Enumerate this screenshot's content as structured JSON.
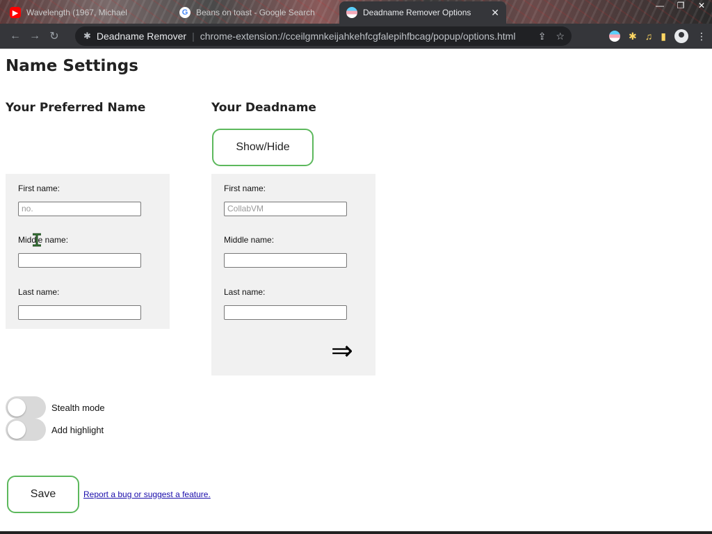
{
  "browser": {
    "tabs": [
      {
        "title": "Wavelength (1967, Michael",
        "icon": "youtube-icon"
      },
      {
        "title": "Beans on toast - Google Search",
        "icon": "google-icon"
      },
      {
        "title": "Deadname Remover Options",
        "icon": "trans-flag-icon",
        "active": true
      }
    ],
    "close_glyph": "✕",
    "site_name": "Deadname Remover",
    "separator": "|",
    "url": "chrome-extension://cceilgmnkeijahkehfcgfalepihfbcag/popup/options.html"
  },
  "page": {
    "title": "Name Settings",
    "preferred": {
      "heading": "Your Preferred Name",
      "first_label": "First name:",
      "first_value": "no.",
      "middle_label": "Middle name:",
      "middle_value": "",
      "last_label": "Last name:",
      "last_value": ""
    },
    "deadname": {
      "heading": "Your Deadname",
      "show_hide_label": "Show/Hide",
      "first_label": "First name:",
      "first_value": "CollabVM",
      "middle_label": "Middle name:",
      "middle_value": "",
      "last_label": "Last name:",
      "last_value": "",
      "arrow_glyph": "⇒"
    },
    "toggles": {
      "stealth_label": "Stealth mode",
      "stealth_on": false,
      "highlight_label": "Add highlight",
      "highlight_on": false
    },
    "save_label": "Save",
    "report_link": "Report a bug or suggest a feature."
  }
}
